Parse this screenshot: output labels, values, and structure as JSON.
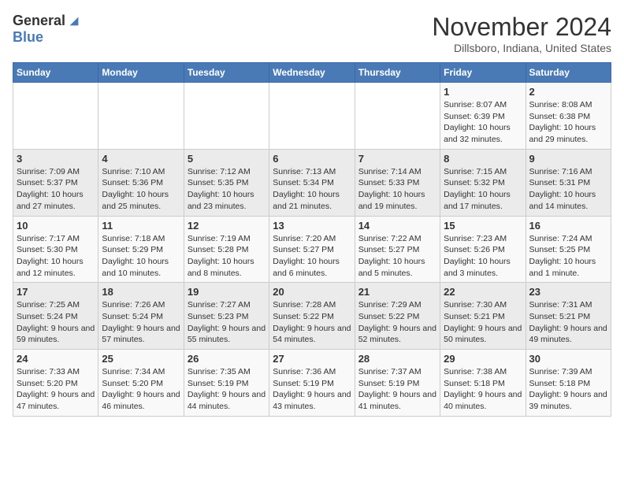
{
  "header": {
    "logo_general": "General",
    "logo_blue": "Blue",
    "month": "November 2024",
    "location": "Dillsboro, Indiana, United States"
  },
  "weekdays": [
    "Sunday",
    "Monday",
    "Tuesday",
    "Wednesday",
    "Thursday",
    "Friday",
    "Saturday"
  ],
  "weeks": [
    [
      {
        "day": "",
        "info": ""
      },
      {
        "day": "",
        "info": ""
      },
      {
        "day": "",
        "info": ""
      },
      {
        "day": "",
        "info": ""
      },
      {
        "day": "",
        "info": ""
      },
      {
        "day": "1",
        "info": "Sunrise: 8:07 AM\nSunset: 6:39 PM\nDaylight: 10 hours and 32 minutes."
      },
      {
        "day": "2",
        "info": "Sunrise: 8:08 AM\nSunset: 6:38 PM\nDaylight: 10 hours and 29 minutes."
      }
    ],
    [
      {
        "day": "3",
        "info": "Sunrise: 7:09 AM\nSunset: 5:37 PM\nDaylight: 10 hours and 27 minutes."
      },
      {
        "day": "4",
        "info": "Sunrise: 7:10 AM\nSunset: 5:36 PM\nDaylight: 10 hours and 25 minutes."
      },
      {
        "day": "5",
        "info": "Sunrise: 7:12 AM\nSunset: 5:35 PM\nDaylight: 10 hours and 23 minutes."
      },
      {
        "day": "6",
        "info": "Sunrise: 7:13 AM\nSunset: 5:34 PM\nDaylight: 10 hours and 21 minutes."
      },
      {
        "day": "7",
        "info": "Sunrise: 7:14 AM\nSunset: 5:33 PM\nDaylight: 10 hours and 19 minutes."
      },
      {
        "day": "8",
        "info": "Sunrise: 7:15 AM\nSunset: 5:32 PM\nDaylight: 10 hours and 17 minutes."
      },
      {
        "day": "9",
        "info": "Sunrise: 7:16 AM\nSunset: 5:31 PM\nDaylight: 10 hours and 14 minutes."
      }
    ],
    [
      {
        "day": "10",
        "info": "Sunrise: 7:17 AM\nSunset: 5:30 PM\nDaylight: 10 hours and 12 minutes."
      },
      {
        "day": "11",
        "info": "Sunrise: 7:18 AM\nSunset: 5:29 PM\nDaylight: 10 hours and 10 minutes."
      },
      {
        "day": "12",
        "info": "Sunrise: 7:19 AM\nSunset: 5:28 PM\nDaylight: 10 hours and 8 minutes."
      },
      {
        "day": "13",
        "info": "Sunrise: 7:20 AM\nSunset: 5:27 PM\nDaylight: 10 hours and 6 minutes."
      },
      {
        "day": "14",
        "info": "Sunrise: 7:22 AM\nSunset: 5:27 PM\nDaylight: 10 hours and 5 minutes."
      },
      {
        "day": "15",
        "info": "Sunrise: 7:23 AM\nSunset: 5:26 PM\nDaylight: 10 hours and 3 minutes."
      },
      {
        "day": "16",
        "info": "Sunrise: 7:24 AM\nSunset: 5:25 PM\nDaylight: 10 hours and 1 minute."
      }
    ],
    [
      {
        "day": "17",
        "info": "Sunrise: 7:25 AM\nSunset: 5:24 PM\nDaylight: 9 hours and 59 minutes."
      },
      {
        "day": "18",
        "info": "Sunrise: 7:26 AM\nSunset: 5:24 PM\nDaylight: 9 hours and 57 minutes."
      },
      {
        "day": "19",
        "info": "Sunrise: 7:27 AM\nSunset: 5:23 PM\nDaylight: 9 hours and 55 minutes."
      },
      {
        "day": "20",
        "info": "Sunrise: 7:28 AM\nSunset: 5:22 PM\nDaylight: 9 hours and 54 minutes."
      },
      {
        "day": "21",
        "info": "Sunrise: 7:29 AM\nSunset: 5:22 PM\nDaylight: 9 hours and 52 minutes."
      },
      {
        "day": "22",
        "info": "Sunrise: 7:30 AM\nSunset: 5:21 PM\nDaylight: 9 hours and 50 minutes."
      },
      {
        "day": "23",
        "info": "Sunrise: 7:31 AM\nSunset: 5:21 PM\nDaylight: 9 hours and 49 minutes."
      }
    ],
    [
      {
        "day": "24",
        "info": "Sunrise: 7:33 AM\nSunset: 5:20 PM\nDaylight: 9 hours and 47 minutes."
      },
      {
        "day": "25",
        "info": "Sunrise: 7:34 AM\nSunset: 5:20 PM\nDaylight: 9 hours and 46 minutes."
      },
      {
        "day": "26",
        "info": "Sunrise: 7:35 AM\nSunset: 5:19 PM\nDaylight: 9 hours and 44 minutes."
      },
      {
        "day": "27",
        "info": "Sunrise: 7:36 AM\nSunset: 5:19 PM\nDaylight: 9 hours and 43 minutes."
      },
      {
        "day": "28",
        "info": "Sunrise: 7:37 AM\nSunset: 5:19 PM\nDaylight: 9 hours and 41 minutes."
      },
      {
        "day": "29",
        "info": "Sunrise: 7:38 AM\nSunset: 5:18 PM\nDaylight: 9 hours and 40 minutes."
      },
      {
        "day": "30",
        "info": "Sunrise: 7:39 AM\nSunset: 5:18 PM\nDaylight: 9 hours and 39 minutes."
      }
    ]
  ]
}
